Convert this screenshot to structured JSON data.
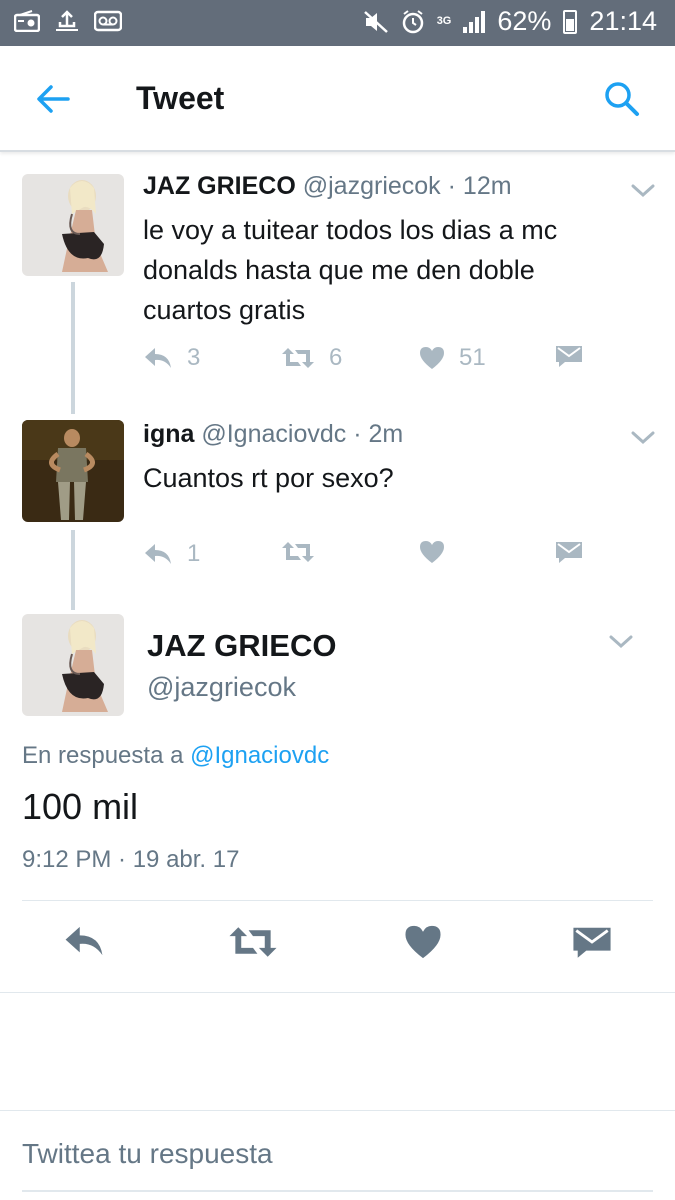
{
  "status_bar": {
    "battery": "62%",
    "time": "21:14",
    "network": "3G"
  },
  "header": {
    "title": "Tweet"
  },
  "thread": [
    {
      "name": "JAZ GRIECO",
      "handle": "@jazgriecok",
      "time": "12m",
      "text": "le voy a tuitear todos los dias a mc donalds hasta que me den doble cuartos gratis",
      "replies": "3",
      "retweets": "6",
      "likes": "51"
    },
    {
      "name": "igna",
      "handle": "@Ignaciovdc",
      "time": "2m",
      "text": "Cuantos rt por sexo?",
      "replies": "1",
      "retweets": "",
      "likes": ""
    }
  ],
  "main_tweet": {
    "name": "JAZ GRIECO",
    "handle": "@jazgriecok",
    "reply_prefix": "En respuesta a",
    "reply_to": "@Ignaciovdc",
    "text": "100 mil",
    "date": "9:12 PM · 19 abr. 17"
  },
  "reply_box": {
    "placeholder": "Twittea tu respuesta"
  },
  "colors": {
    "status_bar": "#636d7a",
    "accent": "#1da1f2",
    "icon_gray": "#aab8c2",
    "main_icon": "#657786"
  }
}
